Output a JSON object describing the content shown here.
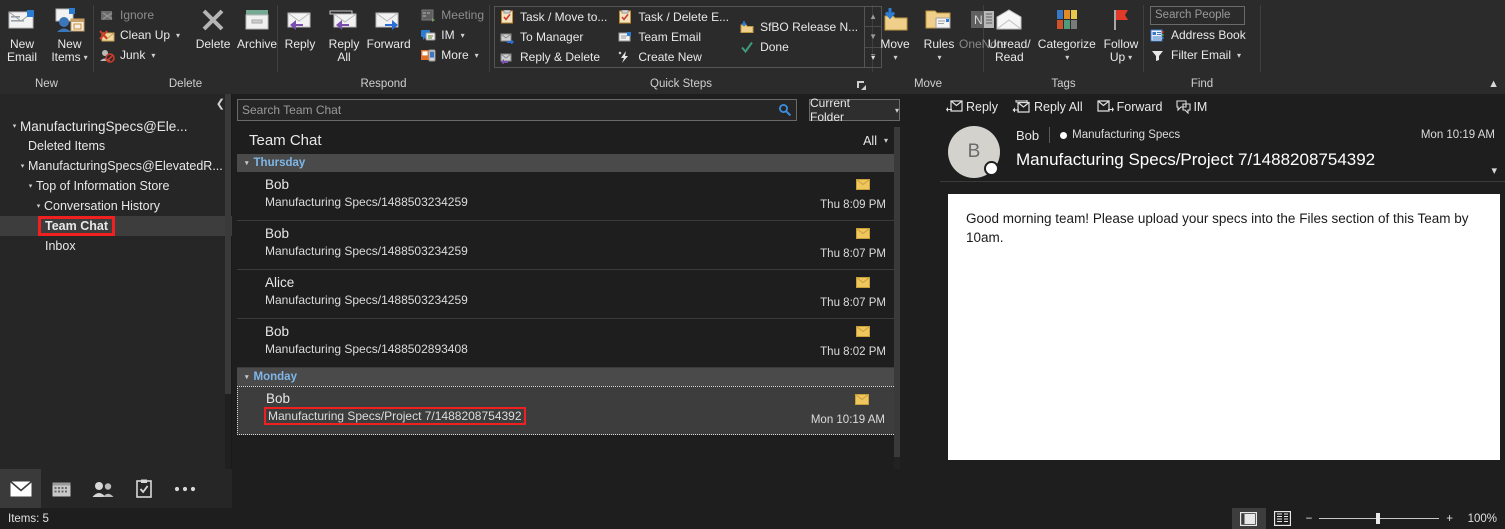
{
  "ribbon": {
    "groups": [
      {
        "name": "New",
        "label": "New",
        "buttons": [
          {
            "label": "New\nEmail",
            "label_l1": "New",
            "label_l2": "Email",
            "icon": "new-email-icon"
          },
          {
            "label": "New\nItems",
            "label_l1": "New",
            "label_l2": "Items",
            "icon": "new-items-icon",
            "caret": true
          }
        ]
      },
      {
        "name": "Delete",
        "label": "Delete",
        "small_buttons": [
          {
            "label": "Ignore",
            "icon": "ignore-icon",
            "disabled": true
          },
          {
            "label": "Clean Up",
            "icon": "clean-up-icon",
            "caret": true
          },
          {
            "label": "Junk",
            "icon": "junk-icon",
            "caret": true
          }
        ],
        "buttons": [
          {
            "label_l1": "Delete",
            "label_l2": "",
            "icon": "delete-icon"
          },
          {
            "label_l1": "Archive",
            "label_l2": "",
            "icon": "archive-icon"
          }
        ]
      },
      {
        "name": "Respond",
        "label": "Respond",
        "buttons": [
          {
            "label_l1": "Reply",
            "label_l2": "",
            "icon": "reply-icon"
          },
          {
            "label_l1": "Reply",
            "label_l2": "All",
            "icon": "reply-all-icon"
          },
          {
            "label_l1": "Forward",
            "label_l2": "",
            "icon": "forward-icon"
          }
        ],
        "small_buttons": [
          {
            "label": "Meeting",
            "icon": "meeting-icon",
            "disabled": true
          },
          {
            "label": "IM",
            "icon": "im-icon",
            "caret": true
          },
          {
            "label": "More",
            "icon": "more-icon",
            "caret": true
          }
        ]
      },
      {
        "name": "Quick Steps",
        "label": "Quick Steps",
        "items": [
          {
            "label": "Task / Move to...",
            "icon": "task-move-icon"
          },
          {
            "label": "To Manager",
            "icon": "to-manager-icon"
          },
          {
            "label": "Reply & Delete",
            "icon": "reply-delete-icon"
          },
          {
            "label": "Task / Delete E...",
            "icon": "task-delete-icon"
          },
          {
            "label": "Team Email",
            "icon": "team-email-icon"
          },
          {
            "label": "Create New",
            "icon": "create-new-icon"
          },
          {
            "label": "SfBO Release N...",
            "icon": "sfbo-release-icon"
          },
          {
            "label": "Done",
            "icon": "done-icon"
          }
        ]
      },
      {
        "name": "Move",
        "label": "Move",
        "buttons": [
          {
            "label_l1": "Move",
            "label_l2": "",
            "icon": "move-icon",
            "caret": true
          },
          {
            "label_l1": "Rules",
            "label_l2": "",
            "icon": "rules-icon",
            "caret": true
          },
          {
            "label_l1": "OneNote",
            "label_l2": "",
            "icon": "onenote-icon",
            "disabled": true
          }
        ]
      },
      {
        "name": "Tags",
        "label": "Tags",
        "buttons": [
          {
            "label_l1": "Unread/",
            "label_l2": "Read",
            "icon": "unread-read-icon"
          },
          {
            "label_l1": "Categorize",
            "label_l2": "",
            "icon": "categorize-icon",
            "caret": true
          },
          {
            "label_l1": "Follow",
            "label_l2": "Up",
            "icon": "follow-up-icon",
            "caret": true
          }
        ]
      },
      {
        "name": "Find",
        "label": "Find",
        "search_people_placeholder": "Search People",
        "small_buttons": [
          {
            "label": "Address Book",
            "icon": "address-book-icon"
          },
          {
            "label": "Filter Email",
            "icon": "filter-email-icon",
            "caret": true
          }
        ]
      }
    ]
  },
  "folder_pane": {
    "items": [
      {
        "label": "ManufacturingSpecs@Ele...",
        "indent": 0,
        "expander": true,
        "selected": false,
        "highlight": false
      },
      {
        "label": "Deleted Items",
        "indent": 1,
        "expander": false,
        "selected": false,
        "highlight": false
      },
      {
        "label": "ManufacturingSpecs@ElevatedR...",
        "indent": 0,
        "expander": true,
        "selected": false,
        "highlight": false
      },
      {
        "label": "Top of Information Store",
        "indent": 1,
        "expander": true,
        "selected": false,
        "highlight": false
      },
      {
        "label": "Conversation History",
        "indent": 2,
        "expander": true,
        "selected": false,
        "highlight": false
      },
      {
        "label": "Team Chat",
        "indent": 3,
        "expander": false,
        "selected": true,
        "highlight": true
      },
      {
        "label": "Inbox",
        "indent": 3,
        "expander": false,
        "selected": false,
        "highlight": false
      }
    ]
  },
  "message_list": {
    "search_placeholder": "Search Team Chat",
    "scope_label": "Current Folder",
    "title": "Team Chat",
    "filter_label": "All",
    "groups": [
      {
        "date": "Thursday",
        "messages": [
          {
            "from": "Bob",
            "subject": "Manufacturing Specs/1488503234259",
            "time": "Thu 8:09 PM",
            "selected": false,
            "highlight_subject": false
          },
          {
            "from": "Bob",
            "subject": "Manufacturing Specs/1488503234259",
            "time": "Thu 8:07 PM",
            "selected": false,
            "highlight_subject": false
          },
          {
            "from": "Alice",
            "subject": "Manufacturing Specs/1488503234259",
            "time": "Thu 8:07 PM",
            "selected": false,
            "highlight_subject": false
          },
          {
            "from": "Bob",
            "subject": "Manufacturing Specs/1488502893408",
            "time": "Thu 8:02 PM",
            "selected": false,
            "highlight_subject": false
          }
        ]
      },
      {
        "date": "Monday",
        "messages": [
          {
            "from": "Bob",
            "subject": "Manufacturing Specs/Project 7/1488208754392",
            "time": "Mon 10:19 AM",
            "selected": true,
            "highlight_subject": true
          }
        ]
      }
    ]
  },
  "reading_pane": {
    "actions": [
      {
        "label": "Reply",
        "icon": "reply-icon"
      },
      {
        "label": "Reply All",
        "icon": "reply-all-icon"
      },
      {
        "label": "Forward",
        "icon": "forward-icon"
      },
      {
        "label": "IM",
        "icon": "im-icon"
      }
    ],
    "avatar_initial": "B",
    "from": "Bob",
    "team": "Manufacturing Specs",
    "time": "Mon 10:19 AM",
    "subject": "Manufacturing Specs/Project 7/1488208754392",
    "body": "Good morning team! Please upload your specs into the Files section of this Team by 10am."
  },
  "nav_bar": {
    "items": [
      {
        "icon": "mail-icon",
        "selected": true
      },
      {
        "icon": "calendar-icon",
        "selected": false
      },
      {
        "icon": "people-icon",
        "selected": false
      },
      {
        "icon": "tasks-icon",
        "selected": false
      },
      {
        "icon": "more-ellipsis-icon",
        "selected": false
      }
    ]
  },
  "status_bar": {
    "items_count": "Items: 5",
    "zoom_level": "100%",
    "zoom_minus": "−",
    "zoom_plus": "+"
  },
  "colors": {
    "accent_red": "#f02020",
    "ribbon_bg": "#2b2b2b",
    "pane_bg": "#1e1e1e",
    "date_header_bg": "#4a4a4a",
    "date_header_text": "#7fb7e8",
    "selection_bg": "#3d3d3d",
    "body_bg": "#ffffff"
  }
}
